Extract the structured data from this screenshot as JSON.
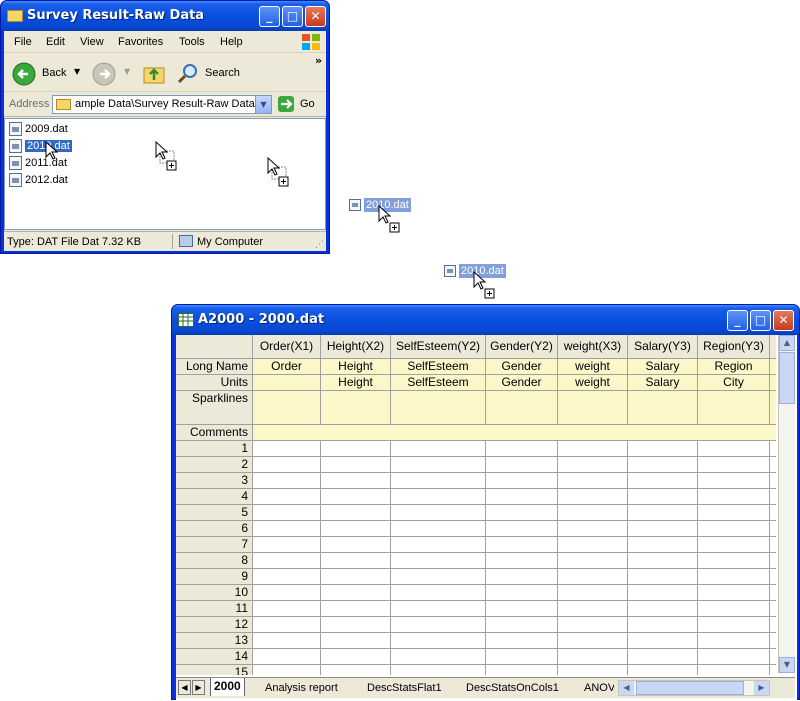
{
  "explorer": {
    "title": "Survey Result-Raw Data",
    "menu": [
      "File",
      "Edit",
      "View",
      "Favorites",
      "Tools",
      "Help"
    ],
    "toolbar": {
      "back_label": "Back",
      "search_label": "Search",
      "more": "»"
    },
    "address": {
      "label": "Address",
      "value": "ample Data\\Survey Result-Raw Data",
      "go_label": "Go"
    },
    "files": [
      "2009.dat",
      "2010.dat",
      "2011.dat",
      "2012.dat"
    ],
    "selected_file": "2010.dat",
    "status": {
      "type_text": "Type: DAT File Dat 7.32 KB",
      "location": "My Computer"
    }
  },
  "drag_ghosts": [
    "2010.dat",
    "2010.dat"
  ],
  "worksheet": {
    "title": "A2000 - 2000.dat",
    "columns": [
      "Order(X1)",
      "Height(X2)",
      "SelfEsteem(Y2)",
      "Gender(Y2)",
      "weight(X3)",
      "Salary(Y3)",
      "Region(Y3)"
    ],
    "row_labels": {
      "long_name": "Long Name",
      "units": "Units",
      "sparklines": "Sparklines",
      "comments": "Comments"
    },
    "long_names": [
      "Order",
      "Height",
      "SelfEsteem",
      "Gender",
      "weight",
      "Salary",
      "Region"
    ],
    "units": [
      "",
      "Height",
      "SelfEsteem",
      "Gender",
      "weight",
      "Salary",
      "City"
    ],
    "row_numbers": [
      "1",
      "2",
      "3",
      "4",
      "5",
      "6",
      "7",
      "8",
      "9",
      "10",
      "11",
      "12",
      "13",
      "14",
      "15"
    ],
    "tabs": [
      "2000",
      "Analysis report",
      "DescStatsFlat1",
      "DescStatsOnCols1",
      "ANOV"
    ],
    "active_tab": "2000"
  }
}
